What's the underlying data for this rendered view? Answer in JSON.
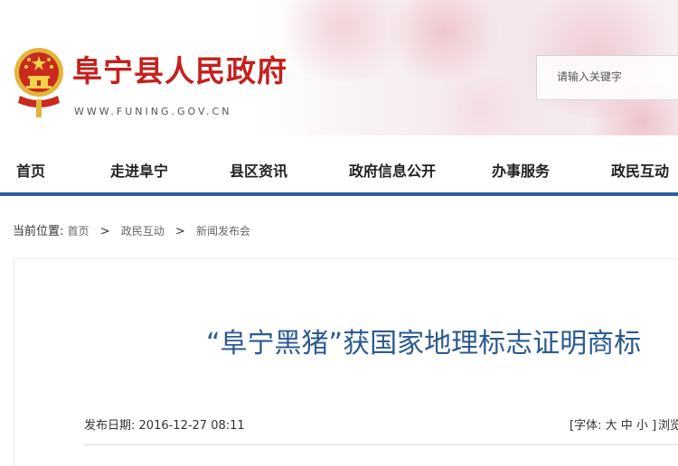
{
  "header": {
    "site_title": "阜宁县人民政府",
    "site_url": "WWW.FUNING.GOV.CN",
    "emblem_icon": "national-emblem-icon",
    "colors": {
      "title_red": "#c4201c",
      "nav_blue": "#2f5ea1",
      "headline_blue": "#2b5a91"
    }
  },
  "search": {
    "placeholder": "请输入关键字",
    "value": ""
  },
  "nav": {
    "items": [
      {
        "label": "首页"
      },
      {
        "label": "走进阜宁"
      },
      {
        "label": "县区资讯"
      },
      {
        "label": "政府信息公开"
      },
      {
        "label": "办事服务"
      },
      {
        "label": "政民互动"
      }
    ]
  },
  "breadcrumb": {
    "prefix": "当前位置:",
    "items": [
      "首页",
      "政民互动",
      "新闻发布会"
    ],
    "separator": ">"
  },
  "article": {
    "title": "“阜宁黑猪”获国家地理标志证明商标",
    "publish_label": "发布日期:",
    "publish_date": "2016-12-27 08:11",
    "font_label_open": "[字体:",
    "font_large": "大",
    "font_medium": "中",
    "font_small": "小",
    "font_label_close": "]",
    "views_label": "浏览"
  }
}
